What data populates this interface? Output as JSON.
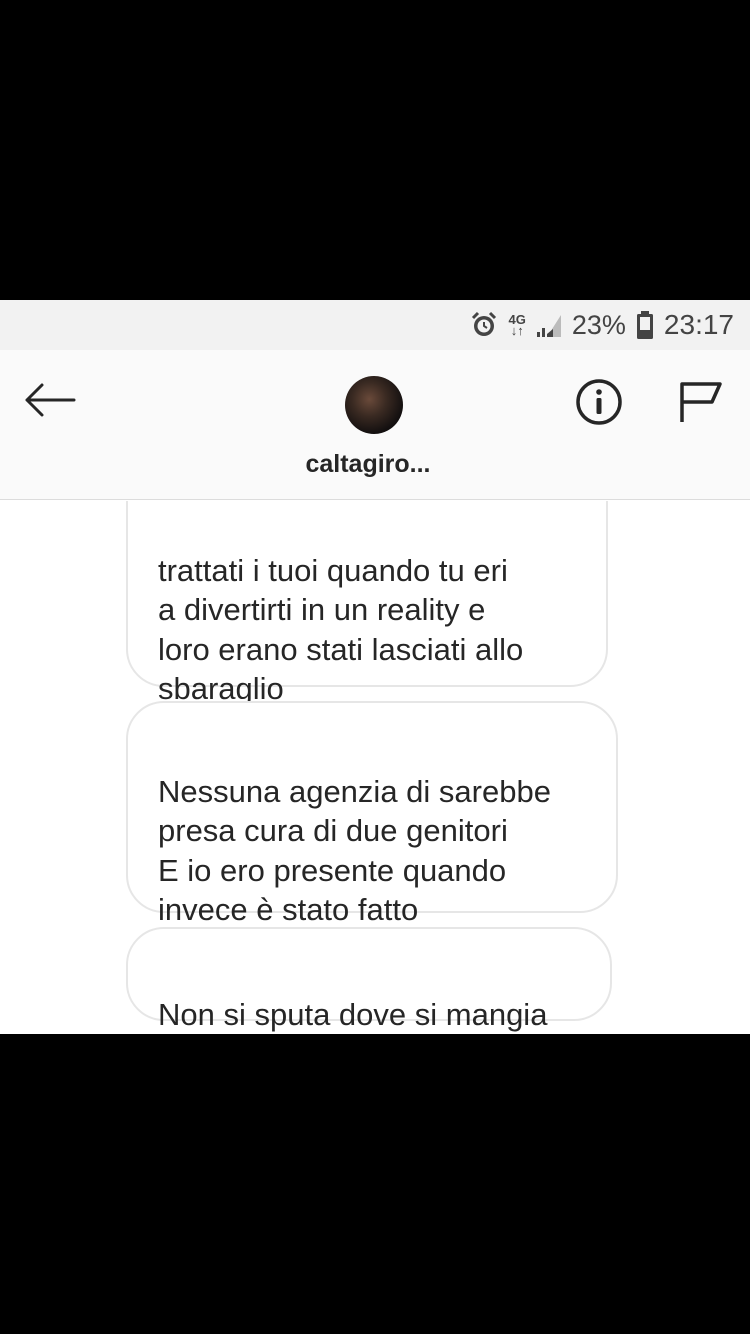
{
  "status_bar": {
    "network_top": "4G",
    "network_bottom": "↓↑",
    "battery_percent": "23%",
    "time": "23:17",
    "icons": [
      "alarm-icon",
      "network-4g-icon",
      "signal-icon",
      "battery-icon"
    ]
  },
  "header": {
    "username": "caltagiro...",
    "icons": [
      "back-arrow-icon",
      "avatar",
      "info-icon",
      "flag-icon"
    ]
  },
  "messages": [
    {
      "text": "trattati i tuoi quando tu eri\na divertirti in un reality e\nloro erano stati lasciati allo\nsbaraglio"
    },
    {
      "text": "Nessuna agenzia di sarebbe\npresa cura di due genitori\nE io ero presente quando\ninvece è stato fatto"
    },
    {
      "text": "Non si sputa dove si mangia"
    }
  ],
  "colors": {
    "status_bar_bg": "#f2f2f2",
    "header_bg": "#fafafa",
    "bubble_border": "#e6e6e6",
    "text": "#262626"
  }
}
